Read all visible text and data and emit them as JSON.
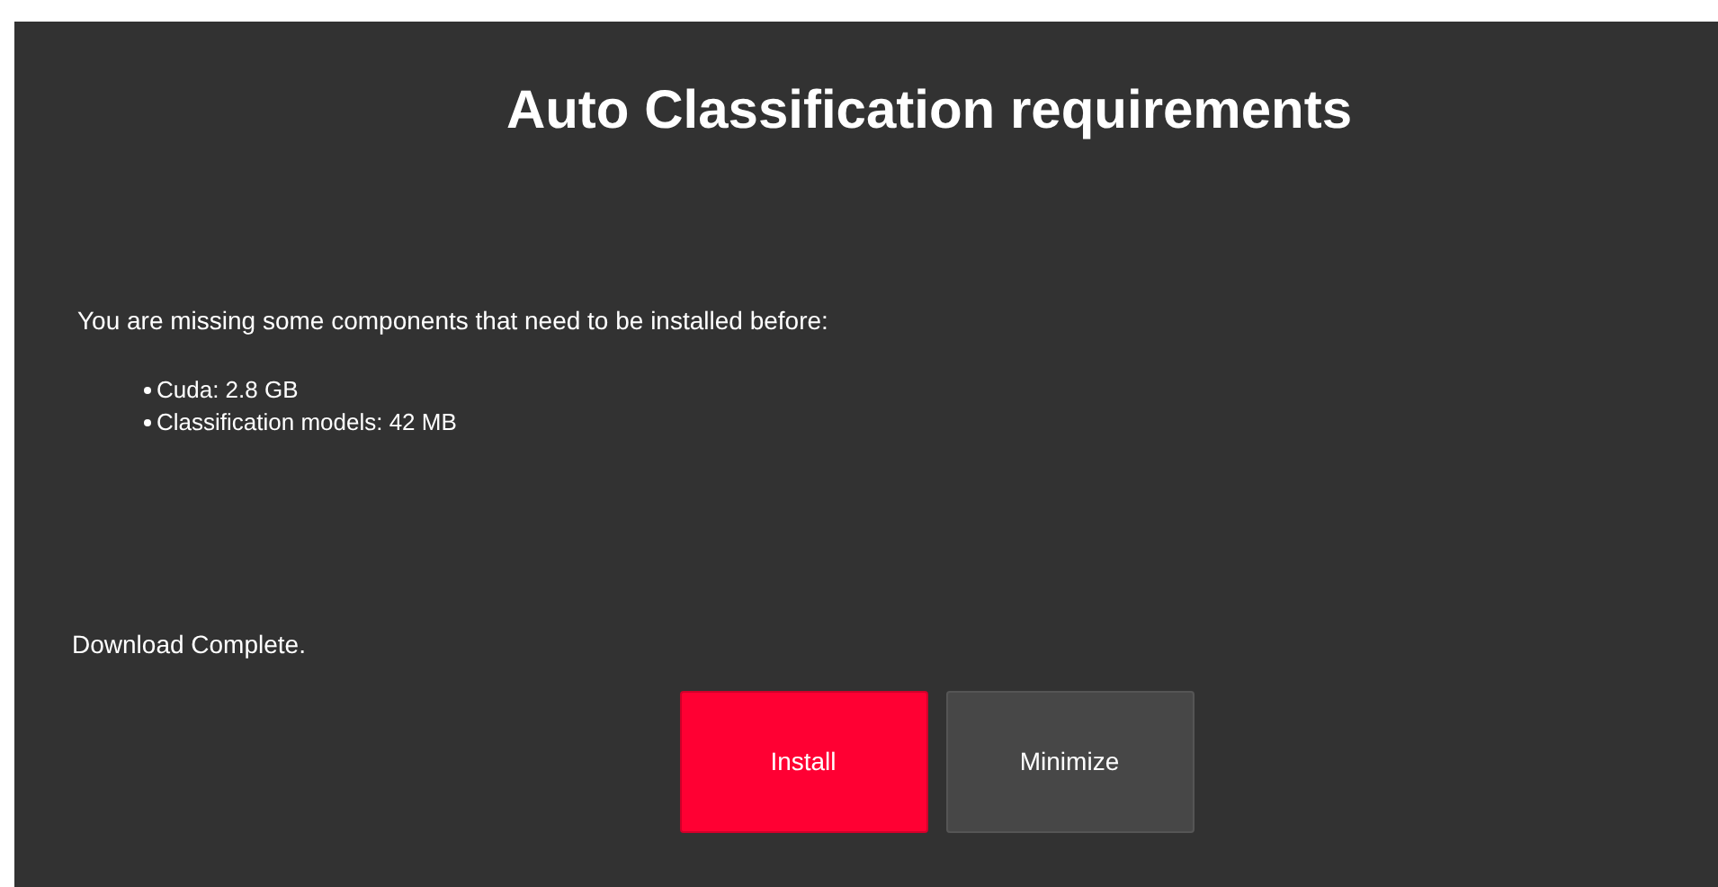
{
  "dialog": {
    "title": "Auto Classification requirements",
    "message": "You are missing some components that need to be installed before:",
    "requirements": [
      {
        "text": "Cuda: 2.8 GB"
      },
      {
        "text": "Classification models: 42 MB"
      }
    ],
    "status": "Download Complete.",
    "buttons": [
      {
        "label": "Install",
        "kind": "primary"
      },
      {
        "label": "Minimize",
        "kind": "secondary"
      }
    ]
  }
}
